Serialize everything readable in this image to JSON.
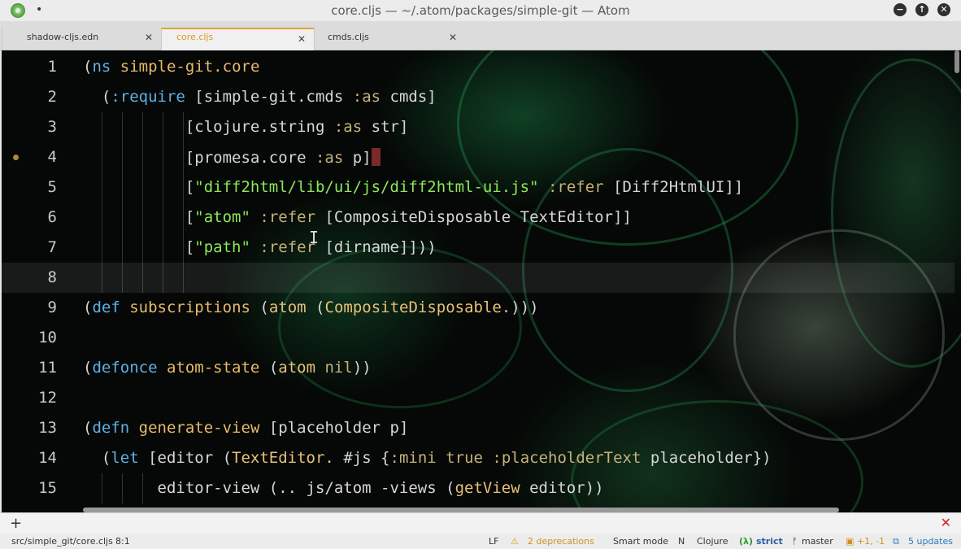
{
  "window": {
    "title": "core.cljs — ~/.atom/packages/simple-git — Atom",
    "menu_dot": "•"
  },
  "window_buttons": {
    "minimize": "−",
    "maximize": "↑",
    "close": "✕"
  },
  "tabs": [
    {
      "label": "shadow-cljs.edn",
      "close": "✕"
    },
    {
      "label": "core.cljs",
      "close": "✕",
      "active": true
    },
    {
      "label": "cmds.cljs",
      "close": "✕"
    }
  ],
  "editor": {
    "line_numbers": [
      "1",
      "2",
      "3",
      "4",
      "5",
      "6",
      "7",
      "8",
      "9",
      "10",
      "11",
      "12",
      "13",
      "14",
      "15"
    ],
    "current_line": "8",
    "modified_line": "4"
  },
  "panel": {
    "add": "+",
    "close": "✕"
  },
  "status": {
    "path": "src/simple_git/core.cljs",
    "position": "8:1",
    "line_ending": "LF",
    "deprecations": "2 deprecations",
    "smart_mode": "Smart mode",
    "n": "N",
    "grammar": "Clojure",
    "lambda": "(λ)",
    "strict": "strict",
    "branch": "master",
    "diff": "+1, -1",
    "updates": "5 updates"
  },
  "colors": {
    "keyword": "#5fb0e8",
    "function": "#e8b96b",
    "string": "#8de85a",
    "active_tab": "#d49a26"
  }
}
